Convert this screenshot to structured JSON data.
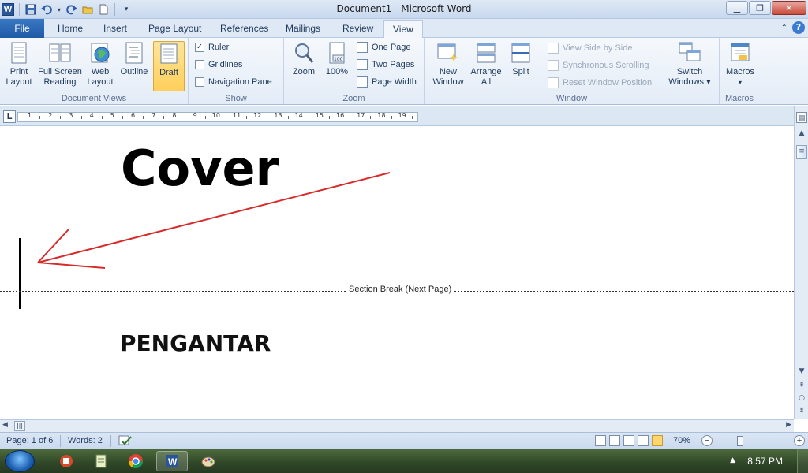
{
  "window": {
    "title": "Document1  -  Microsoft Word"
  },
  "tabs": {
    "file": "File",
    "home": "Home",
    "insert": "Insert",
    "page_layout": "Page Layout",
    "references": "References",
    "mailings": "Mailings",
    "review": "Review",
    "view": "View"
  },
  "ribbon": {
    "document_views": {
      "label": "Document Views",
      "print_layout": "Print Layout",
      "full_screen_reading": "Full Screen Reading",
      "web_layout": "Web Layout",
      "outline": "Outline",
      "draft": "Draft"
    },
    "show": {
      "label": "Show",
      "ruler": "Ruler",
      "gridlines": "Gridlines",
      "navigation_pane": "Navigation Pane",
      "ruler_checked": "✓"
    },
    "zoom": {
      "label": "Zoom",
      "zoom": "Zoom",
      "hundred": "100%",
      "one_page": "One Page",
      "two_pages": "Two Pages",
      "page_width": "Page Width"
    },
    "window": {
      "label": "Window",
      "new_window": "New Window",
      "arrange_all": "Arrange All",
      "split": "Split",
      "view_side_by_side": "View Side by Side",
      "synchronous_scrolling": "Synchronous Scrolling",
      "reset_window_position": "Reset Window Position",
      "switch_windows": "Switch Windows ▾"
    },
    "macros": {
      "label": "Macros",
      "macros": "Macros"
    }
  },
  "ruler": {
    "tab_selector": "L",
    "numbers": [
      "1",
      "2",
      "3",
      "4",
      "5",
      "6",
      "7",
      "8",
      "9",
      "10",
      "11",
      "12",
      "13",
      "14",
      "15",
      "16",
      "17",
      "18",
      "19"
    ]
  },
  "document": {
    "heading_cover": "Cover",
    "section_break": "Section Break (Next Page)",
    "heading_pengantar": "PENGANTAR"
  },
  "status": {
    "page": "Page: 1 of 6",
    "words": "Words: 2",
    "zoom": "70%"
  },
  "taskbar": {
    "time": "8:57 PM"
  }
}
